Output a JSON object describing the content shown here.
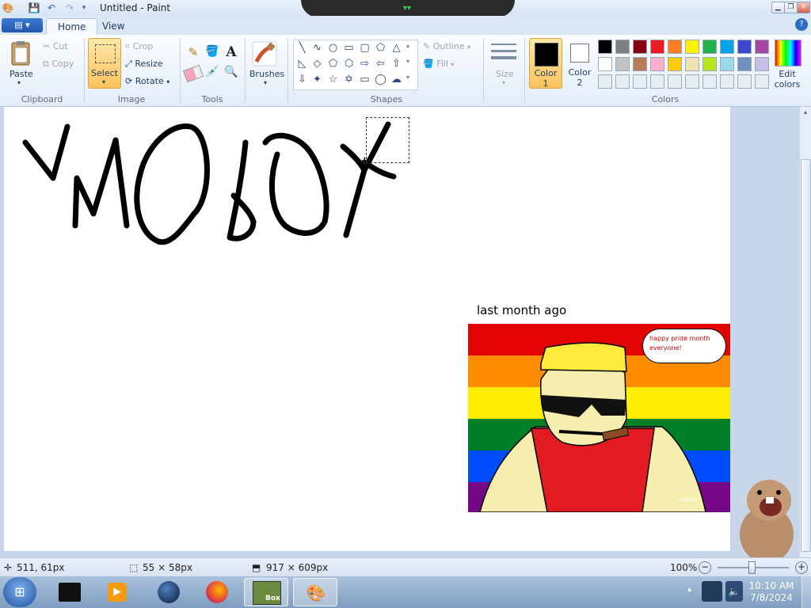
{
  "window": {
    "title": "Untitled - Paint"
  },
  "tabs": {
    "home": "Home",
    "view": "View"
  },
  "clipboard": {
    "paste": "Paste",
    "cut": "Cut",
    "copy": "Copy",
    "group": "Clipboard"
  },
  "image": {
    "select": "Select",
    "crop": "Crop",
    "resize": "Resize",
    "rotate": "Rotate",
    "group": "Image"
  },
  "tools": {
    "group": "Tools"
  },
  "brushes": {
    "label": "Brushes"
  },
  "shapes": {
    "outline": "Outline",
    "fill": "Fill",
    "group": "Shapes"
  },
  "size": {
    "label": "Size"
  },
  "colors": {
    "color1_line1": "Color",
    "color1_line2": "1",
    "color2_line1": "Color",
    "color2_line2": "2",
    "edit_line1": "Edit",
    "edit_line2": "colors",
    "group": "Colors",
    "color1": "#000000",
    "color2": "#ffffff",
    "palette_row1": [
      "#000000",
      "#7f7f7f",
      "#880015",
      "#ed1c24",
      "#ff7f27",
      "#fff200",
      "#22b14c",
      "#00a2e8",
      "#3f48cc",
      "#a349a4"
    ],
    "palette_row2": [
      "#ffffff",
      "#c3c3c3",
      "#b97a57",
      "#ffaec9",
      "#ffc90e",
      "#efe4b0",
      "#b5e61d",
      "#99d9ea",
      "#7092be",
      "#c8bfe7"
    ],
    "palette_row3": [
      "#e6edf5",
      "#e6edf5",
      "#e6edf5",
      "#e6edf5",
      "#e6edf5",
      "#e6edf5",
      "#e6edf5",
      "#e6edf5",
      "#e6edf5",
      "#e6edf5"
    ]
  },
  "canvas": {
    "meme_caption": "last month ago",
    "speech_bubble": "happy pride month everyone!",
    "signature": "zosrpa"
  },
  "status": {
    "cursor_pos": "511, 61px",
    "selection_size": "55 × 58px",
    "image_size": "917 × 609px",
    "zoom": "100%"
  },
  "taskbar": {
    "time": "10:10 AM",
    "date": "7/8/2024",
    "box_label": "Box"
  }
}
